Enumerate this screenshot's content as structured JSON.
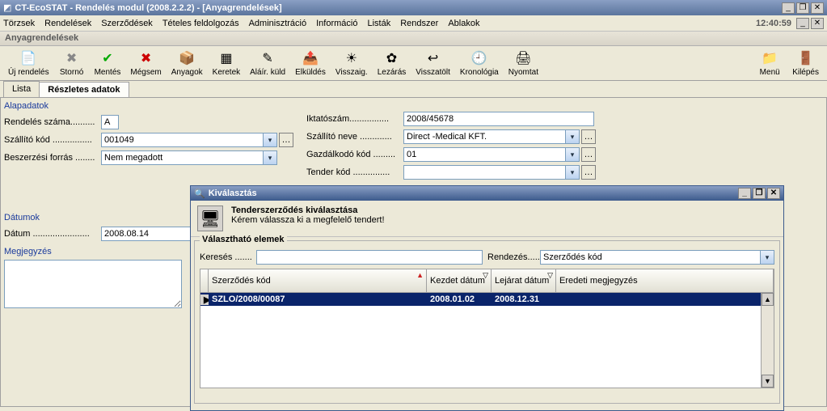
{
  "window": {
    "title": "CT-EcoSTAT - Rendelés modul (2008.2.2.2) - [Anyagrendelések]",
    "time": "12:40:59"
  },
  "menu": [
    "Törzsek",
    "Rendelések",
    "Szerződések",
    "Tételes feldolgozás",
    "Adminisztráció",
    "Információ",
    "Listák",
    "Rendszer",
    "Ablakok"
  ],
  "innerTitle": "Anyagrendelések",
  "toolbar": [
    {
      "icon": "📄",
      "label": "Új rendelés"
    },
    {
      "icon": "✖",
      "label": "Stornó",
      "color": "#888"
    },
    {
      "icon": "✔",
      "label": "Mentés",
      "color": "#0a0"
    },
    {
      "icon": "✖",
      "label": "Mégsem",
      "color": "#c00"
    },
    {
      "icon": "📦",
      "label": "Anyagok"
    },
    {
      "icon": "▦",
      "label": "Keretek"
    },
    {
      "icon": "✎",
      "label": "Aláír. küld"
    },
    {
      "icon": "📤",
      "label": "Elküldés"
    },
    {
      "icon": "☀",
      "label": "Visszaig."
    },
    {
      "icon": "✿",
      "label": "Lezárás"
    },
    {
      "icon": "↩",
      "label": "Visszatölt"
    },
    {
      "icon": "🕘",
      "label": "Kronológia"
    },
    {
      "icon": "🖨",
      "label": "Nyomtat"
    }
  ],
  "toolbarRight": [
    {
      "icon": "📁",
      "label": "Menü"
    },
    {
      "icon": "🚪",
      "label": "Kilépés"
    }
  ],
  "tabs": {
    "lista": "Lista",
    "reszletes": "Részletes adatok"
  },
  "sections": {
    "alap": "Alapadatok",
    "datumok": "Dátumok",
    "megj": "Megjegyzés"
  },
  "labels": {
    "rendelesSzama": "Rendelés száma..........",
    "szallitoKod": "Szállító kód ................",
    "beszforras": "Beszerzési forrás ........",
    "iktatoszam": "Iktatószám................",
    "szallitoNeve": "Szállító neve .............",
    "gazdalkodo": "Gazdálkodó kód .........",
    "tenderkod": "Tender kód ...............",
    "datum": "Dátum ......................."
  },
  "values": {
    "rendelesSzama": "A",
    "szallitoKod": "001049",
    "beszforras": "Nem megadott",
    "iktatoszam": "2008/45678",
    "szallitoNeve": "Direct -Medical KFT.",
    "gazdalkodo": "01",
    "tenderkod": "",
    "datum": "2008.08.14"
  },
  "dialog": {
    "title": "Kiválasztás",
    "head1": "Tenderszerződés kiválasztása",
    "head2": "Kérem válassza ki a megfelelő tendert!",
    "group": "Választható elemek",
    "kereses": "Keresés .......",
    "rendezes": "Rendezés.....",
    "rendezesVal": "Szerződés kód",
    "cols": {
      "szerzkod": "Szerződés kód",
      "kezdet": "Kezdet dátum",
      "lejarat": "Lejárat dátum",
      "eredeti": "Eredeti megjegyzés"
    },
    "row": {
      "szerzkod": "SZLO/2008/00087",
      "kezdet": "2008.01.02",
      "lejarat": "2008.12.31",
      "eredeti": ""
    }
  }
}
